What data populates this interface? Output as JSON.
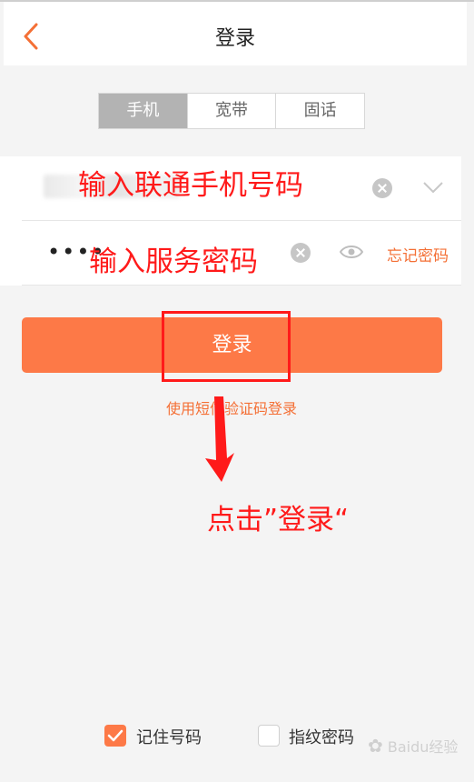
{
  "header": {
    "title": "登录",
    "back_icon": "chevron-left-icon"
  },
  "tabs": [
    {
      "label": "手机",
      "active": true
    },
    {
      "label": "宽带",
      "active": false
    },
    {
      "label": "固话",
      "active": false
    }
  ],
  "form": {
    "phone": {
      "value_obscured": true
    },
    "password": {
      "masked_value": "••••",
      "forgot_label": "忘记密码"
    }
  },
  "login_button_label": "登录",
  "sms_login_label": "使用短信验证码登录",
  "annotations": {
    "phone_hint": "输入联通手机号码",
    "password_hint": "输入服务密码",
    "click_hint": "点击”登录“"
  },
  "options": {
    "remember": {
      "label": "记住号码",
      "checked": true
    },
    "fingerprint": {
      "label": "指纹密码",
      "checked": false
    }
  },
  "watermark": {
    "text": "Baidu经验"
  },
  "colors": {
    "accent": "#fd7947",
    "link": "#f47036",
    "annotation": "#ff1a1a",
    "tab_active_bg": "#b3b3b3"
  }
}
